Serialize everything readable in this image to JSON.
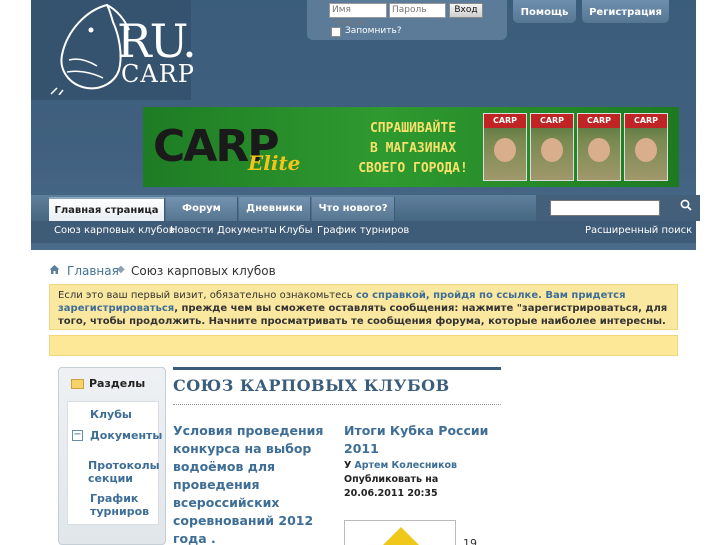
{
  "header": {
    "logo_ru": "RU.",
    "logo_carp": "CARP",
    "login": {
      "username_placeholder": "Имя пользо",
      "password_placeholder": "Пароль",
      "login_button": "Вход",
      "remember_label": "Запомнить?"
    },
    "help_button": "Помощь",
    "register_button": "Регистрация"
  },
  "banner": {
    "brand": "CARP",
    "brand_suffix": "Elite",
    "line1": "СПРАШИВАЙТЕ",
    "line2": "В МАГАЗИНАХ",
    "line3": "СВОЕГО ГОРОДА!",
    "magazine_label": "CARP"
  },
  "navbar": {
    "tabs": [
      {
        "label": "Главная страница",
        "active": true
      },
      {
        "label": "Форум",
        "active": false
      },
      {
        "label": "Дневники",
        "active": false
      },
      {
        "label": "Что нового?",
        "active": false
      }
    ],
    "search_icon": "magnifier-icon"
  },
  "subnav": {
    "items": [
      "Союз карповых клубов",
      "Новости",
      "Документы",
      "Клубы",
      "График турниров"
    ],
    "advanced_search": "Расширенный поиск"
  },
  "breadcrumb": {
    "home": "Главная",
    "current": "Союз карповых клубов"
  },
  "notice": {
    "text1": "Если это ваш первый визит, обязательно ознакомьтесь ",
    "link1": "со справкой, пройдя по ссылке.",
    "text2": " Вам придется ",
    "link2": "зарегистрироваться",
    "text3": ", прежде чем вы сможете оставлять сообщения: нажмите \"зарегистрироваться, для того, чтобы продолжить. Начните просматривать те сообщения форума, которые наиболее интересны."
  },
  "sidebar": {
    "heading": "Разделы",
    "items": [
      "Клубы",
      "Документы",
      "Протоколы секции",
      "График турниров"
    ]
  },
  "main": {
    "title": "СОЮЗ КАРПОВЫХ КЛУБОВ",
    "articles": [
      {
        "title": "Условия проведения конкурса на выбор водоёмов для проведения всероссийских соревнований 2012 года ."
      },
      {
        "title": "Итоги Кубка России 2011",
        "by": "У",
        "author": "Артем Колесников",
        "published": "Опубликовать на 20.06.2011 20:35"
      }
    ],
    "page_fragment": "19"
  },
  "colors": {
    "header_bg": "#41607f",
    "link": "#3e6e96",
    "notice_bg": "#fbe8a0",
    "banner_green": "#2f9a2f"
  }
}
